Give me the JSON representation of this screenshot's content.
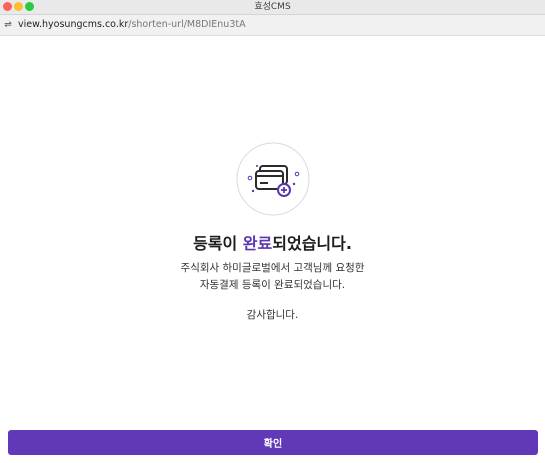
{
  "window": {
    "title": "효성CMS"
  },
  "address_bar": {
    "url_host": "view.hyosungcms.co.kr",
    "url_path": "/shorten-url/M8DIEnu3tA"
  },
  "main": {
    "headline_prefix": "등록이 ",
    "headline_accent": "완료",
    "headline_suffix": "되었습니다.",
    "message_line_1": "주식회사 하미글로벌에서 고객님께 요청한",
    "message_line_2": "자동결제 등록이 완료되었습니다.",
    "thanks": "감사합니다.",
    "confirm_label": "확인"
  },
  "colors": {
    "accent": "#5b35b5",
    "button": "#6038b8"
  },
  "icons": [
    "card-registration-icon",
    "site-settings-icon"
  ]
}
